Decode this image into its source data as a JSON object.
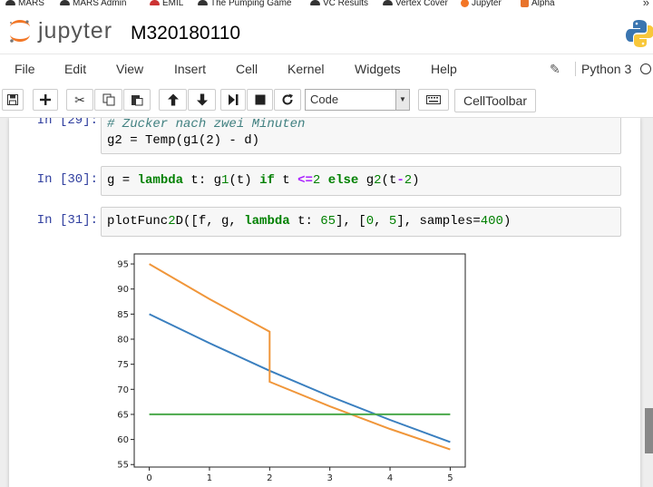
{
  "bookmarks": [
    {
      "label": "MARS",
      "icon": "hat-icon"
    },
    {
      "label": "MARS Admin",
      "icon": "hat-icon"
    },
    {
      "label": "EMIL",
      "icon": "m-icon"
    },
    {
      "label": "The Pumping Game",
      "icon": "hat-icon"
    },
    {
      "label": "VC Results",
      "icon": "hat-icon"
    },
    {
      "label": "Vertex Cover",
      "icon": "hat-icon"
    },
    {
      "label": "Jupyter",
      "icon": "jupyter-icon"
    },
    {
      "label": "Alpha",
      "icon": "gear-icon"
    }
  ],
  "header": {
    "logo_text": "jupyter",
    "notebook_name": "M320180110"
  },
  "menu": [
    "File",
    "Edit",
    "View",
    "Insert",
    "Cell",
    "Kernel",
    "Widgets",
    "Help"
  ],
  "kernel": {
    "name": "Python 3"
  },
  "toolbar": {
    "cell_type": "Code",
    "celltoolbar_label": "CellToolbar"
  },
  "cells": [
    {
      "prompt": "In [29]:",
      "line1_comment": "# Zucker nach zwei Minuten",
      "line2": "g2 = Temp(g1(2) - d)"
    },
    {
      "prompt": "In [30]:",
      "code": "g = lambda t: g1(t) if t <=2 else g2(t-2)"
    },
    {
      "prompt": "In [31]:",
      "code": "plotFunc2D([f, g, lambda t: 65], [0, 5], samples=400)"
    }
  ],
  "chart_data": {
    "type": "line",
    "xlim": [
      -0.25,
      5.25
    ],
    "ylim": [
      54.5,
      97
    ],
    "xticks": [
      0,
      1,
      2,
      3,
      4,
      5
    ],
    "yticks": [
      55,
      60,
      65,
      70,
      75,
      80,
      85,
      90,
      95
    ],
    "grid": false,
    "series": [
      {
        "color": "#3a7fbf",
        "x": [
          0,
          1,
          2,
          3,
          4,
          5
        ],
        "y": [
          85,
          79.2,
          73.7,
          68.6,
          63.9,
          59.5
        ]
      },
      {
        "color": "#f0963a",
        "x": [
          0,
          1,
          2,
          2,
          3,
          4,
          5
        ],
        "y": [
          95,
          88.0,
          81.5,
          71.5,
          66.6,
          62.1,
          58.0
        ]
      },
      {
        "color": "#4aa84a",
        "x": [
          0,
          5
        ],
        "y": [
          65,
          65
        ]
      }
    ]
  }
}
